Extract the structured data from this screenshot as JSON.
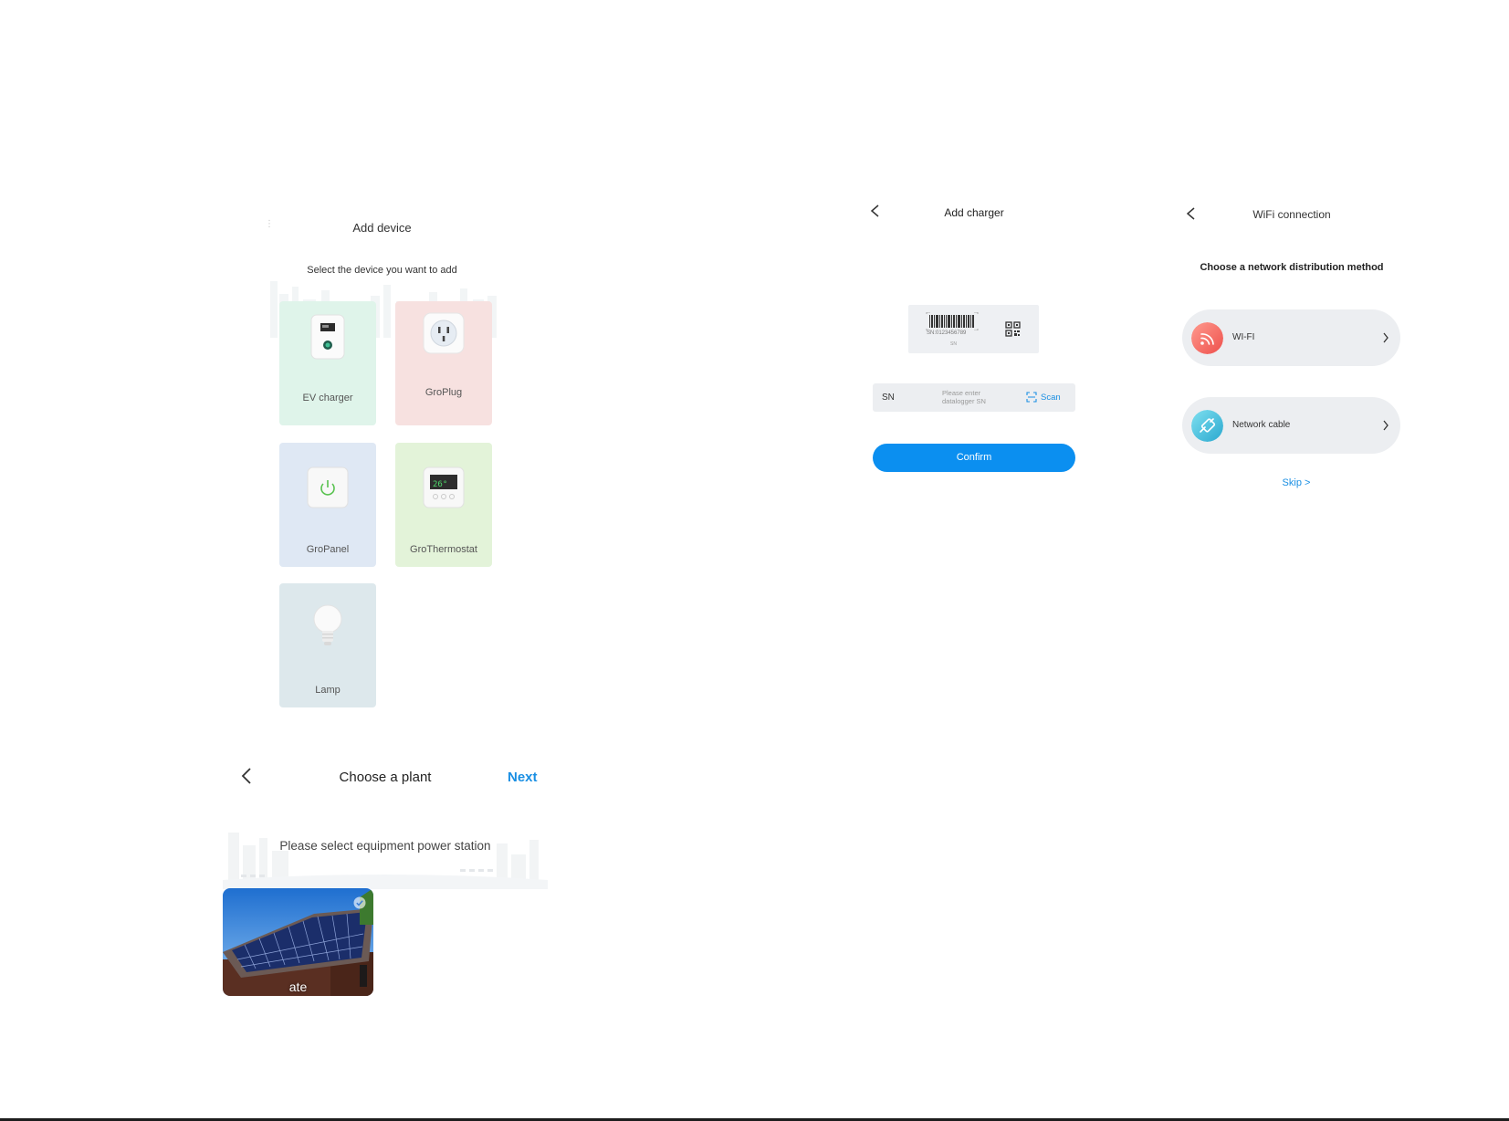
{
  "add_device": {
    "title": "Add device",
    "subtitle": "Select the device you want to add",
    "devices": [
      {
        "label": "EV charger",
        "icon": "ev-charger-icon",
        "bg": "#dff4ea"
      },
      {
        "label": "GroPlug",
        "icon": "plug-icon",
        "bg": "#f7e1e0"
      },
      {
        "label": "GroPanel",
        "icon": "power-panel-icon",
        "bg": "#dfe8f4"
      },
      {
        "label": "GroThermostat",
        "icon": "thermostat-icon",
        "bg": "#e3f3d9"
      },
      {
        "label": "Lamp",
        "icon": "bulb-icon",
        "bg": "#dde8ec"
      }
    ]
  },
  "choose_plant": {
    "title": "Choose a plant",
    "next_label": "Next",
    "subtitle": "Please select equipment power station",
    "plant_name": "ate"
  },
  "add_charger": {
    "title": "Add charger",
    "sample_sn": "SN:0123456789",
    "sample_sn_caption": "SN",
    "sn_label": "SN",
    "sn_placeholder": "Please enter datalogger SN",
    "scan_label": "Scan",
    "confirm_label": "Confirm"
  },
  "wifi_connection": {
    "title": "WiFi connection",
    "subtitle": "Choose a network distribution method",
    "methods": [
      {
        "label": "WI-FI",
        "icon": "wifi-icon",
        "color": "#f26a63"
      },
      {
        "label": "Network cable",
        "icon": "cable-icon",
        "color": "#3bbad6"
      }
    ],
    "skip_label": "Skip  >"
  },
  "colors": {
    "accent": "#1a8fe3",
    "confirm": "#0b8ff0"
  }
}
